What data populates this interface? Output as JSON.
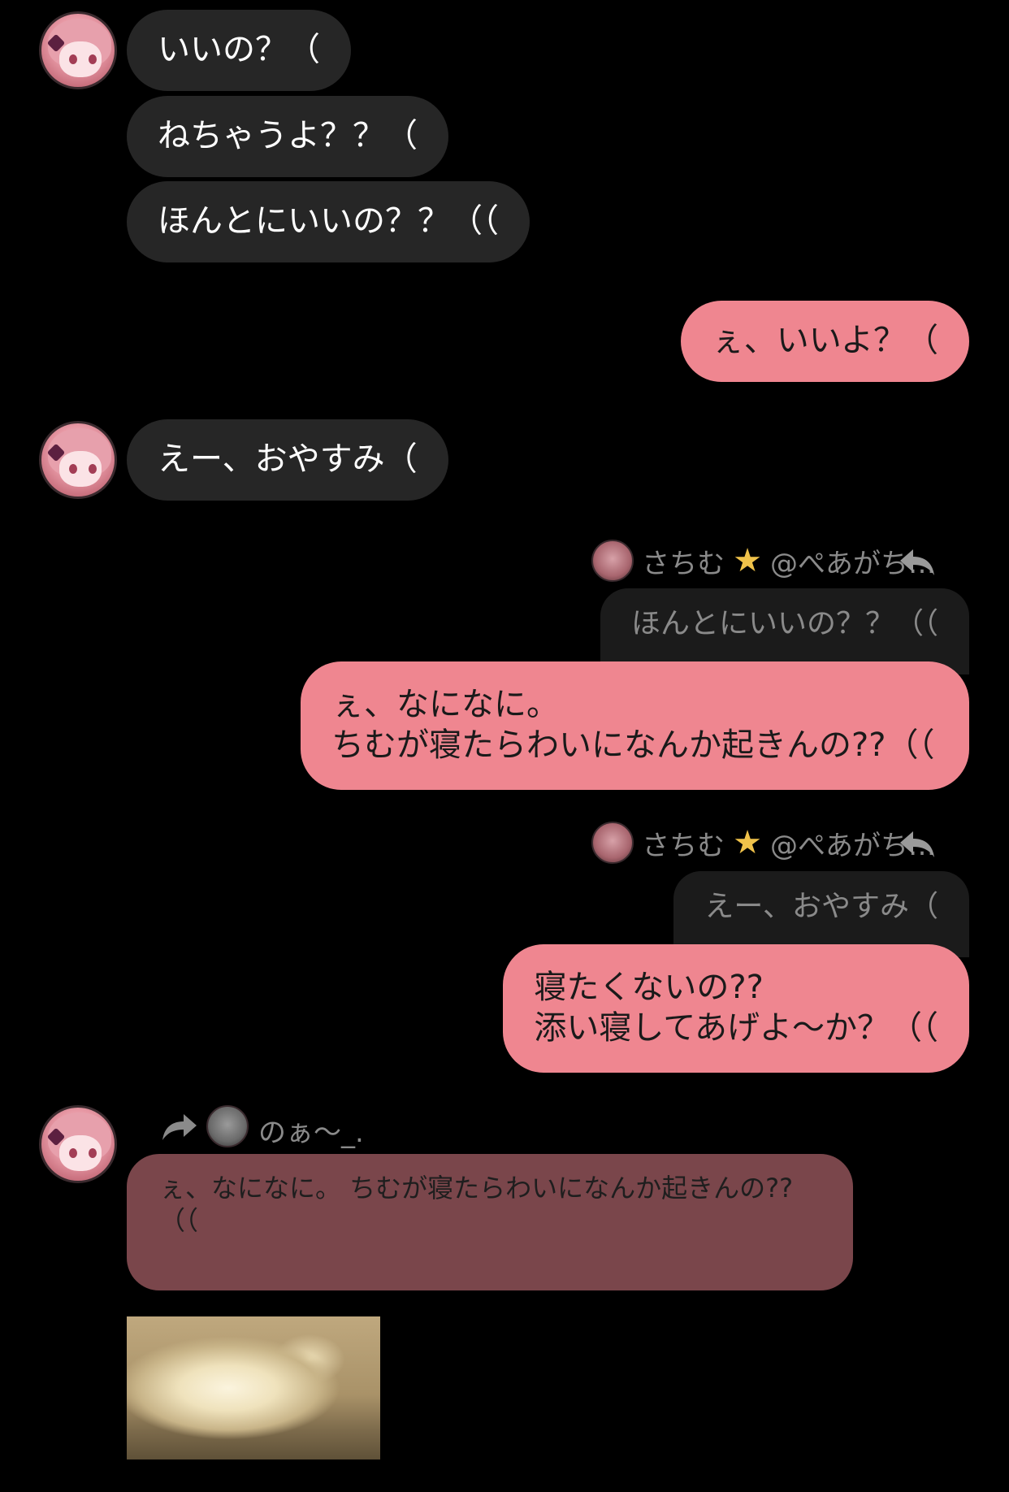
{
  "incoming": {
    "group1": [
      "いいの？（",
      "ねちゃうよ？？（",
      "ほんとにいいの？？（（"
    ],
    "group2": [
      "えー、おやすみ（"
    ]
  },
  "outgoing": {
    "msg1": "ぇ、いいよ？（"
  },
  "reply1": {
    "header_name": "さちむ",
    "header_suffix": "@ぺあがち…",
    "quoted": "ほんとにいいの？？（（",
    "line1": "ぇ、なになに。",
    "line2": "ちむが寝たらわいになんか起きんの??（（"
  },
  "reply2": {
    "header_name": "さちむ",
    "header_suffix": "@ぺあがち…",
    "quoted": "えー、おやすみ（",
    "line1": "寝たくないの??",
    "line2": "添い寝してあげよ～か？（（"
  },
  "forward": {
    "name": "のぁ～_.",
    "text": "ぇ、なになに。 ちむが寝たらわいになんか起きんの??（（"
  },
  "icons": {
    "star": "star-icon",
    "reply": "reply-arrow-icon",
    "forward": "forward-arrow-icon"
  },
  "colors": {
    "incoming_bubble": "#262626",
    "outgoing_bubble": "#ef8690",
    "forward_card": "#7a464b",
    "background": "#000000"
  }
}
